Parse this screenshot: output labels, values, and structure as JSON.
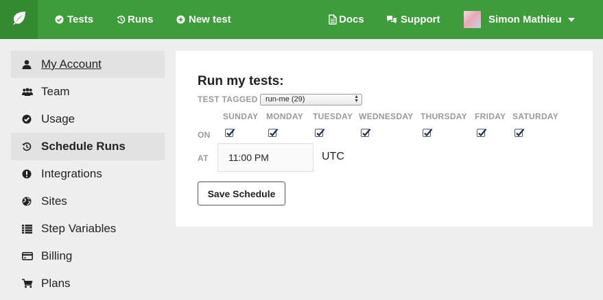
{
  "nav": {
    "logo_icon": "leaf-icon",
    "items": [
      {
        "label": "Tests",
        "icon": "check-circle-icon"
      },
      {
        "label": "Runs",
        "icon": "history-icon"
      },
      {
        "label": "New test",
        "icon": "plus-circle-icon"
      },
      {
        "label": "Docs",
        "icon": "document-icon"
      },
      {
        "label": "Support",
        "icon": "comments-icon"
      }
    ],
    "user": {
      "name": "Simon Mathieu",
      "icon": "caret-down-icon"
    },
    "colors": {
      "bar": "#3f9c3b",
      "logo_bg": "#348a30"
    }
  },
  "sidebar": {
    "items": [
      {
        "label": "My Account",
        "icon": "user-icon"
      },
      {
        "label": "Team",
        "icon": "group-icon"
      },
      {
        "label": "Usage",
        "icon": "check-circle-icon"
      },
      {
        "label": "Schedule Runs",
        "icon": "history-icon"
      },
      {
        "label": "Integrations",
        "icon": "exclamation-circle-icon"
      },
      {
        "label": "Sites",
        "icon": "globe-icon"
      },
      {
        "label": "Step Variables",
        "icon": "list-icon"
      },
      {
        "label": "Billing",
        "icon": "credit-card-icon"
      },
      {
        "label": "Plans",
        "icon": "cart-icon"
      }
    ]
  },
  "schedule": {
    "title": "Run my tests:",
    "tag_label": "TEST TAGGED",
    "tag_selected": "run-me (29)",
    "on_label": "ON",
    "at_label": "AT",
    "days": [
      {
        "name": "SUNDAY",
        "checked": true
      },
      {
        "name": "MONDAY",
        "checked": true
      },
      {
        "name": "TUESDAY",
        "checked": true
      },
      {
        "name": "WEDNESDAY",
        "checked": true
      },
      {
        "name": "THURSDAY",
        "checked": true
      },
      {
        "name": "FRIDAY",
        "checked": true
      },
      {
        "name": "SATURDAY",
        "checked": true
      }
    ],
    "time_value": "11:00 PM",
    "timezone": "UTC",
    "save_label": "Save Schedule"
  }
}
